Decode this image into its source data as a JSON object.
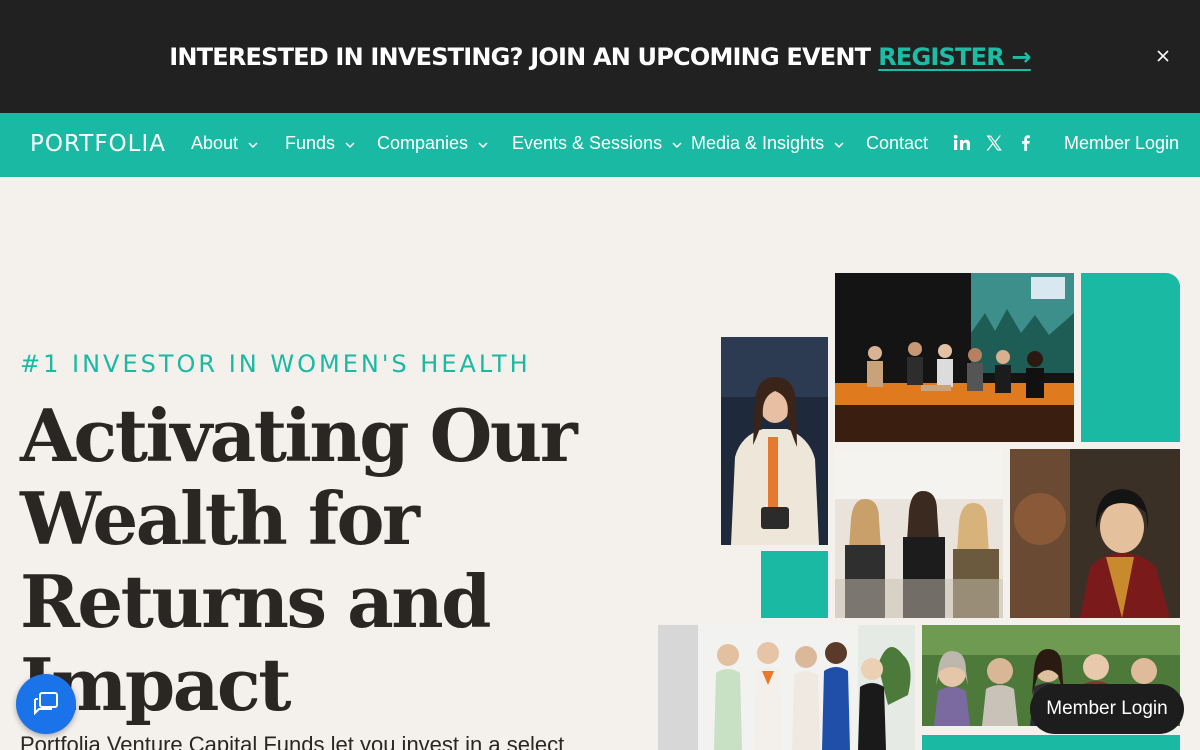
{
  "announcement": {
    "text": "INTERESTED IN INVESTING? JOIN AN UPCOMING EVENT",
    "link_label": "REGISTER →",
    "close_icon": "close-icon"
  },
  "nav": {
    "logo": "PORTFOLIA",
    "items": [
      {
        "label": "About",
        "icon": "chevron-down-icon"
      },
      {
        "label": "Funds",
        "icon": "chevron-down-icon"
      },
      {
        "label": "Companies",
        "icon": "chevron-down-icon"
      },
      {
        "label": "Events & Sessions",
        "icon": "chevron-down-icon"
      },
      {
        "label": "Media & Insights",
        "icon": "chevron-down-icon"
      },
      {
        "label": "Contact"
      }
    ],
    "social": [
      "linkedin-icon",
      "x-twitter-icon",
      "facebook-icon"
    ],
    "member_login": "Member Login"
  },
  "hero": {
    "eyebrow": "#1 INVESTOR IN WOMEN'S HEALTH",
    "headline": "Activating Our Wealth for Returns and Impact",
    "subline": "Portfolia Venture Capital Funds let you invest in a select"
  },
  "floating": {
    "chat_icon": "chat-icon",
    "member_login": "Member Login"
  },
  "colors": {
    "accent": "#1ab9a3",
    "banner_bg": "#212121",
    "page_bg": "#f4f0ec",
    "text": "#2a2624",
    "chat_button": "#1a73e8"
  }
}
